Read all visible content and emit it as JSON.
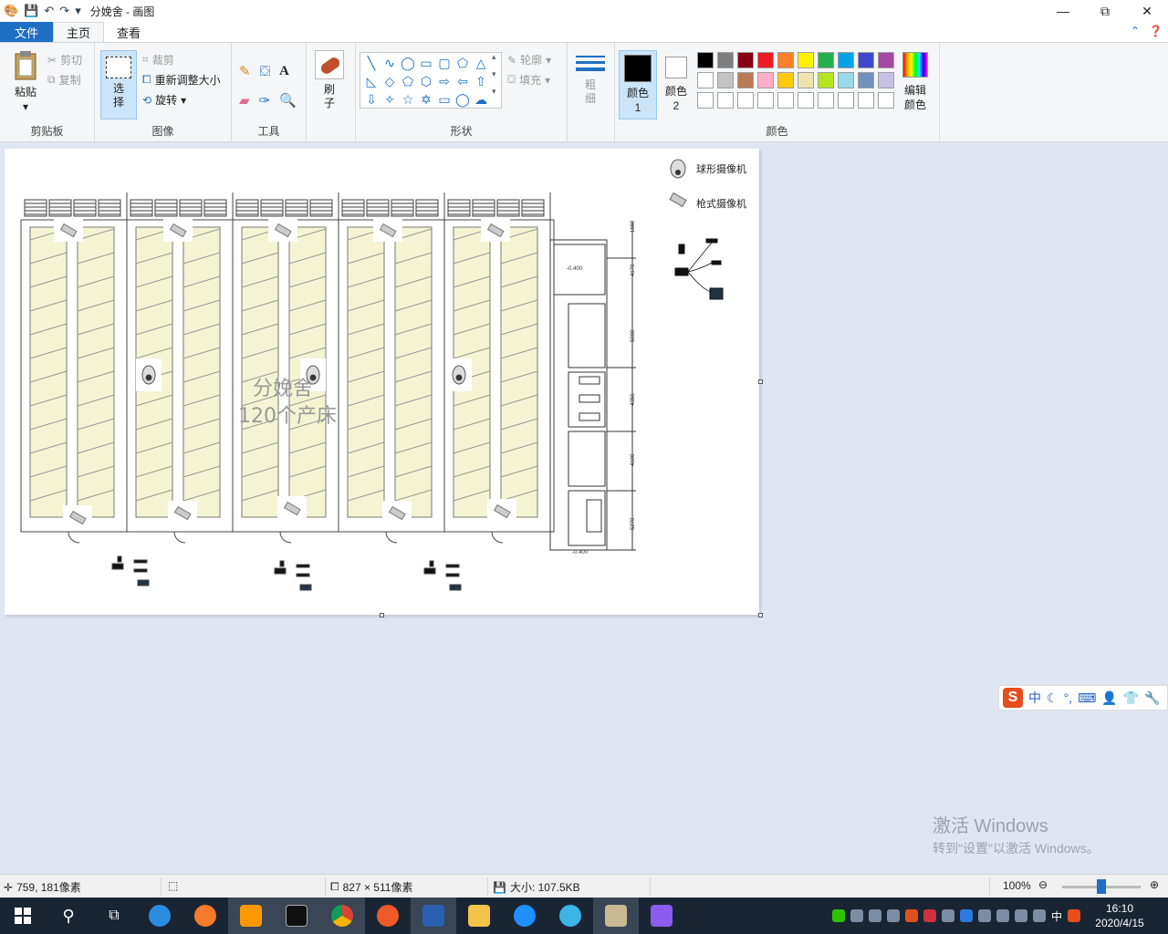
{
  "window": {
    "title": "分娩舍 - 画图",
    "controls": {
      "minimize": "—",
      "maximize": "⧉",
      "close": "✕"
    }
  },
  "tabs": [
    {
      "label": "文件"
    },
    {
      "label": "主页"
    },
    {
      "label": "查看"
    }
  ],
  "ribbon": {
    "clipboard": {
      "label": "剪贴板",
      "paste": "粘贴",
      "cut": "剪切",
      "copy": "复制"
    },
    "image": {
      "label": "图像",
      "select": "选择",
      "crop": "裁剪",
      "resize": "重新调整大小",
      "rotate": "旋转"
    },
    "tools": {
      "label": "工具"
    },
    "brush": {
      "label": "刷子"
    },
    "shapes": {
      "label": "形状",
      "outline": "轮廓",
      "fill": "填充"
    },
    "size": {
      "label": "粗细"
    },
    "colors": {
      "label": "颜色",
      "color1": "颜色 1",
      "color2": "颜色 2",
      "edit": "编辑颜色",
      "palette_row1": [
        "#000000",
        "#7f7f7f",
        "#880015",
        "#ed1c24",
        "#ff7f27",
        "#fff200",
        "#22b14c",
        "#00a2e8",
        "#3f48cc",
        "#a349a4"
      ],
      "palette_row2": [
        "#ffffff",
        "#c3c3c3",
        "#b97a57",
        "#ffaec9",
        "#ffc90e",
        "#efe4b0",
        "#b5e61d",
        "#99d9ea",
        "#7092be",
        "#c8bfe7"
      ],
      "palette_row3": [
        "#ffffff",
        "#ffffff",
        "#ffffff",
        "#ffffff",
        "#ffffff",
        "#ffffff",
        "#ffffff",
        "#ffffff",
        "#ffffff",
        "#ffffff"
      ]
    }
  },
  "canvas_content": {
    "room_label": "分娩舍",
    "bed_count_label": "120个产床",
    "legend": [
      {
        "icon": "dome-camera-icon",
        "label": "球形摄像机"
      },
      {
        "icon": "bullet-camera-icon",
        "label": "枪式摄像机"
      }
    ],
    "dimension_labels": [
      "1660",
      "4170",
      "5000",
      "4350",
      "4100",
      "5270"
    ],
    "room_tags": [
      "-0.400",
      "-0.400"
    ]
  },
  "activation": {
    "title": "激活 Windows",
    "subtitle": "转到\"设置\"以激活 Windows。"
  },
  "statusbar": {
    "cursor_position": "759, 181像素",
    "selection_size": "",
    "image_size": "827 × 511像素",
    "file_size": "大小: 107.5KB",
    "zoom": "100%"
  },
  "taskbar": {
    "time": "16:10",
    "date": "2020/4/15",
    "ime_indicator": "中"
  }
}
